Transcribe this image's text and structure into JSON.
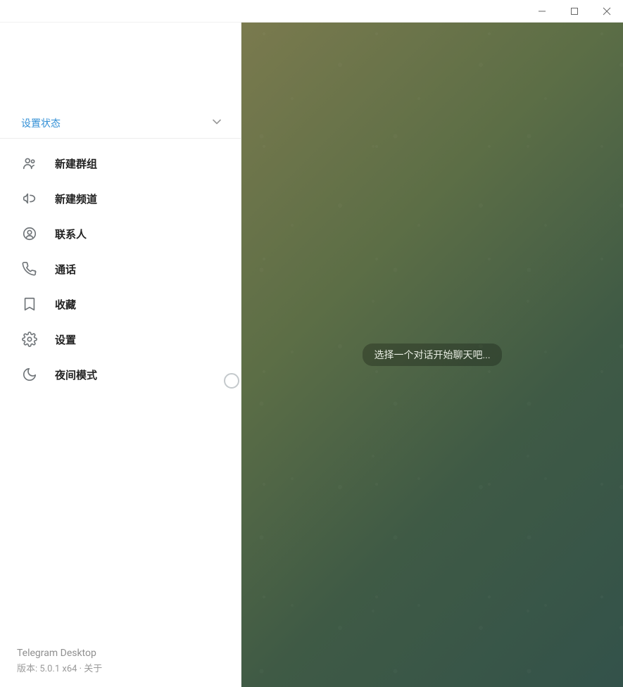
{
  "titlebar": {
    "minimize": "minimize",
    "maximize": "maximize",
    "close": "close"
  },
  "status": {
    "label": "设置状态"
  },
  "menu": {
    "new_group": "新建群组",
    "new_channel": "新建频道",
    "contacts": "联系人",
    "calls": "通话",
    "saved": "收藏",
    "settings": "设置",
    "night_mode": "夜间模式"
  },
  "footer": {
    "app_name": "Telegram Desktop",
    "version_prefix": "版本: ",
    "version": "5.0.1 x64",
    "separator": "  ·  ",
    "about": "关于"
  },
  "main": {
    "empty_prompt": "选择一个对话开始聊天吧..."
  },
  "toggle": {
    "night_mode_on": false
  }
}
